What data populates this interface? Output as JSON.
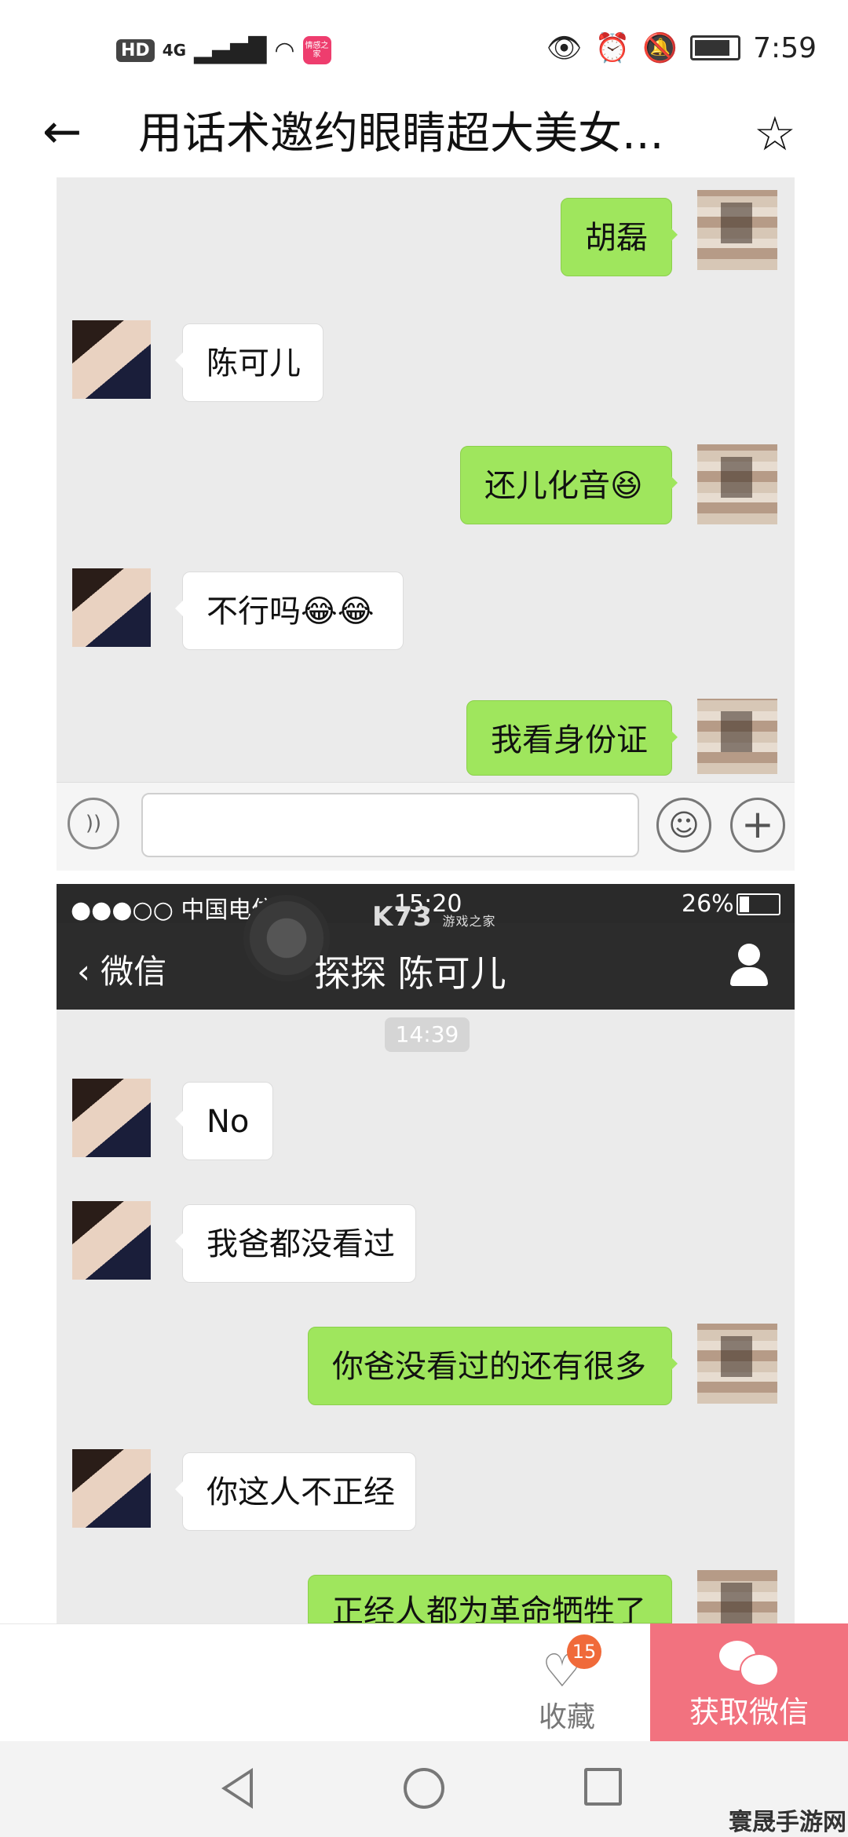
{
  "status_bar": {
    "left_indicators": [
      "HD",
      "4G"
    ],
    "app_badge": "情感之家",
    "time": "7:59"
  },
  "header": {
    "title": "用话术邀约眼睛超大美女..."
  },
  "panel1": {
    "messages": [
      {
        "side": "right",
        "text": "胡磊"
      },
      {
        "side": "left",
        "text": "陈可儿"
      },
      {
        "side": "right",
        "text": "还儿化音😆"
      },
      {
        "side": "left",
        "text": "不行吗😂😂"
      },
      {
        "side": "right",
        "text": "我看身份证"
      }
    ]
  },
  "panel2": {
    "status_carrier": "●●●○○ 中国电信",
    "status_time": "15:20",
    "status_battery": "26%",
    "watermark": "K73",
    "watermark_sub": "游戏之家",
    "nav_back": "微信",
    "nav_title": "探探  陈可儿",
    "timestamp": "14:39",
    "messages": [
      {
        "side": "left",
        "text": "No"
      },
      {
        "side": "left",
        "text": "我爸都没看过"
      },
      {
        "side": "right",
        "text": "你爸没看过的还有很多"
      },
      {
        "side": "left",
        "text": "你这人不正经"
      },
      {
        "side": "right",
        "text": "正经人都为革命牺牲了"
      }
    ]
  },
  "action_bar": {
    "collect_count": "15",
    "collect_label": "收藏",
    "wechat_label": "获取微信"
  },
  "watermark_corner": "寰晟手游网",
  "colors": {
    "bubble_right": "#9fe65d",
    "bubble_left": "#ffffff",
    "wechat_button": "#f2727f",
    "badge": "#f06a3a"
  }
}
